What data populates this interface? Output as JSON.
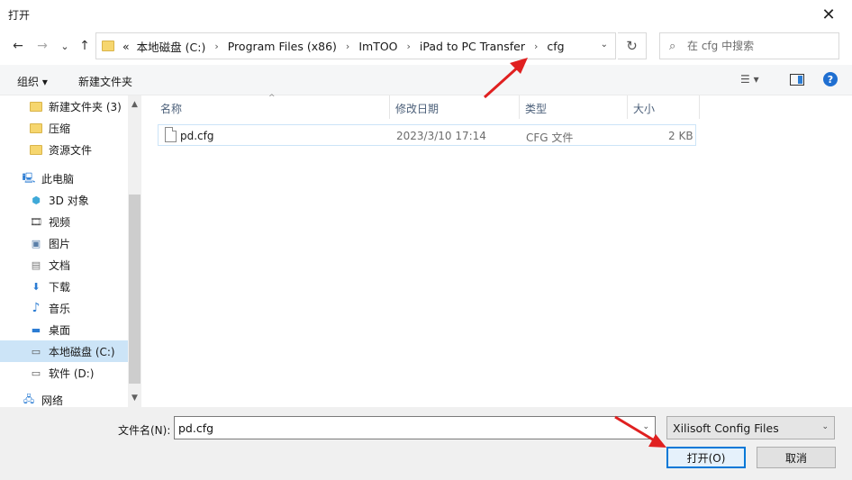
{
  "window": {
    "title": "打开",
    "close_glyph": "✕"
  },
  "nav": {
    "back_glyph": "←",
    "forward_glyph": "→",
    "recent_glyph": "⌄",
    "up_glyph": "↑",
    "breadcrumb_prefix": "«",
    "breadcrumb": [
      "本地磁盘 (C:)",
      "Program Files (x86)",
      "ImTOO",
      "iPad to PC Transfer",
      "cfg"
    ],
    "breadcrumb_sep": "›",
    "dropdown_glyph": "⌄",
    "refresh_glyph": "↻",
    "search_placeholder": "在 cfg 中搜索",
    "search_glyph": "⌕"
  },
  "toolbar": {
    "organize": "组织 ▾",
    "new_folder": "新建文件夹",
    "view_glyph": "☰ ▾",
    "help_glyph": "?"
  },
  "sidebar": {
    "items": [
      {
        "label": "新建文件夹 (3)",
        "icon": "folder-icon",
        "indent": 1
      },
      {
        "label": "压缩",
        "icon": "folder-icon",
        "indent": 1
      },
      {
        "label": "资源文件",
        "icon": "folder-icon",
        "indent": 1
      },
      {
        "label": "此电脑",
        "icon": "computer-icon",
        "indent": 0,
        "glyph": "🖳"
      },
      {
        "label": "3D 对象",
        "icon": "3d-objects-icon",
        "indent": 1,
        "glyph": "⬢"
      },
      {
        "label": "视频",
        "icon": "video-icon",
        "indent": 1,
        "glyph": "🎞"
      },
      {
        "label": "图片",
        "icon": "pictures-icon",
        "indent": 1,
        "glyph": "▣"
      },
      {
        "label": "文档",
        "icon": "documents-icon",
        "indent": 1,
        "glyph": "▤"
      },
      {
        "label": "下载",
        "icon": "downloads-icon",
        "indent": 1,
        "glyph": "⬇"
      },
      {
        "label": "音乐",
        "icon": "music-icon",
        "indent": 1,
        "glyph": "♪"
      },
      {
        "label": "桌面",
        "icon": "desktop-icon",
        "indent": 1,
        "glyph": "▬"
      },
      {
        "label": "本地磁盘 (C:)",
        "icon": "drive-c-icon",
        "indent": 1,
        "glyph": "▭",
        "selected": true
      },
      {
        "label": "软件 (D:)",
        "icon": "drive-d-icon",
        "indent": 1,
        "glyph": "▭"
      },
      {
        "label": "网络",
        "icon": "network-icon",
        "indent": 0,
        "glyph": "🖧"
      }
    ],
    "scroll_up": "▲",
    "scroll_down": "▼"
  },
  "filelist": {
    "columns": [
      "名称",
      "修改日期",
      "类型",
      "大小"
    ],
    "sort_glyph": "^",
    "rows": [
      {
        "name": "pd.cfg",
        "modified": "2023/3/10 17:14",
        "type": "CFG 文件",
        "size": "2 KB"
      }
    ]
  },
  "bottom": {
    "filename_label": "文件名(N):",
    "filename_value": "pd.cfg",
    "filetype": "Xilisoft Config Files",
    "open_button": "打开(O)",
    "cancel_button": "取消",
    "dropdown_glyph": "⌄"
  },
  "colors": {
    "accent": "#0078d7",
    "selection": "#cce4f7",
    "annotation_arrow": "#e02020"
  }
}
